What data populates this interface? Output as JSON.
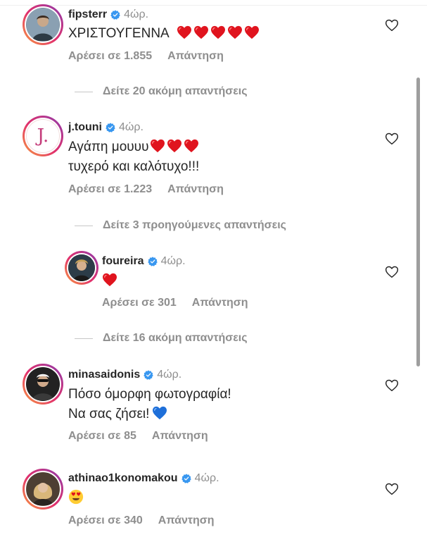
{
  "comments": [
    {
      "username": "fipsterr",
      "time": "4ώρ.",
      "text": "ΧΡΙΣΤΟΥΓΕΝΝΑ",
      "likes": "Αρέσει σε 1.855",
      "reply": "Απάντηση"
    },
    {
      "username": "j.touni",
      "time": "4ώρ.",
      "text_line1": "Αγάπη μουυυ",
      "text_line2": "τυχερό και καλότυχο!!!",
      "likes": "Αρέσει σε 1.223",
      "reply": "Απάντηση"
    },
    {
      "username": "foureira",
      "time": "4ώρ.",
      "likes": "Αρέσει σε 301",
      "reply": "Απάντηση"
    },
    {
      "username": "minasaidonis",
      "time": "4ώρ.",
      "text_line1": "Πόσο όμορφη φωτογραφία!",
      "text_line2": "Να σας ζήσει!",
      "likes": "Αρέσει σε 85",
      "reply": "Απάντηση"
    },
    {
      "username": "athinao1konomakou",
      "time": "4ώρ.",
      "likes": "Αρέσει σε 340",
      "reply": "Απάντηση"
    }
  ],
  "more_replies": [
    "Δείτε 20 ακόμη απαντήσεις",
    "Δείτε 3 προηγούμενες απαντήσεις",
    "Δείτε 16 ακόμη απαντήσεις"
  ],
  "colors": {
    "heart_red": "#e0141e",
    "verified_blue": "#3897f0",
    "muted": "#8e8e8e",
    "blue_heart": "#1e6fd9"
  },
  "icons": {
    "like": "heart-outline-icon",
    "verified": "verified-badge-icon"
  }
}
